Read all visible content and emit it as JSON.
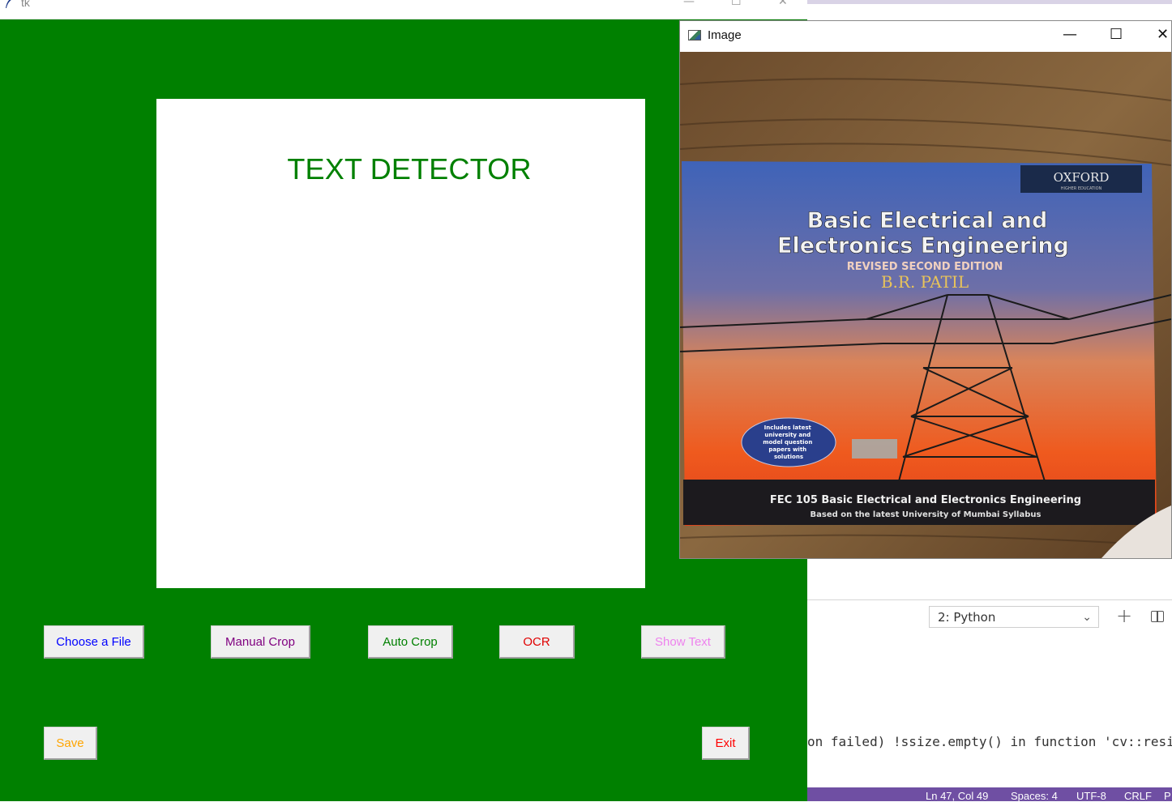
{
  "tk_window": {
    "title": "tk",
    "heading": "TEXT DETECTOR",
    "buttons": {
      "choose_file": "Choose a File",
      "manual_crop": "Manual Crop",
      "auto_crop": "Auto Crop",
      "ocr": "OCR",
      "show_text": "Show Text",
      "save": "Save",
      "exit": "Exit"
    },
    "colors": {
      "background": "#008000",
      "heading": "#008000",
      "choose_file_text": "#0000ff",
      "manual_crop_text": "#800080",
      "auto_crop_text": "#008000",
      "ocr_text": "#e00000",
      "show_text_text": "#ee82ee",
      "save_text": "#ffa500",
      "exit_text": "#ff0000"
    }
  },
  "image_window": {
    "title": "Image",
    "book": {
      "publisher": "OXFORD",
      "publisher_sub": "HIGHER EDUCATION",
      "title_line1": "Basic Electrical and",
      "title_line2": "Electronics Engineering",
      "edition": "REVISED SECOND EDITION",
      "author": "B.R. PATIL",
      "badge": [
        "Includes latest",
        "university and",
        "model question",
        "papers with",
        "solutions"
      ],
      "footer_line1": "FEC 105 Basic Electrical and Electronics Engineering",
      "footer_line2": "Based on the latest University of Mumbai Syllabus"
    }
  },
  "vscode": {
    "terminal_select": "2: Python",
    "terminal_line": "on failed) !ssize.empty() in function 'cv::resize'",
    "status": {
      "position": "Ln 47, Col 49",
      "spaces": "Spaces: 4",
      "encoding": "UTF-8",
      "eol": "CRLF",
      "extra": "P"
    }
  }
}
